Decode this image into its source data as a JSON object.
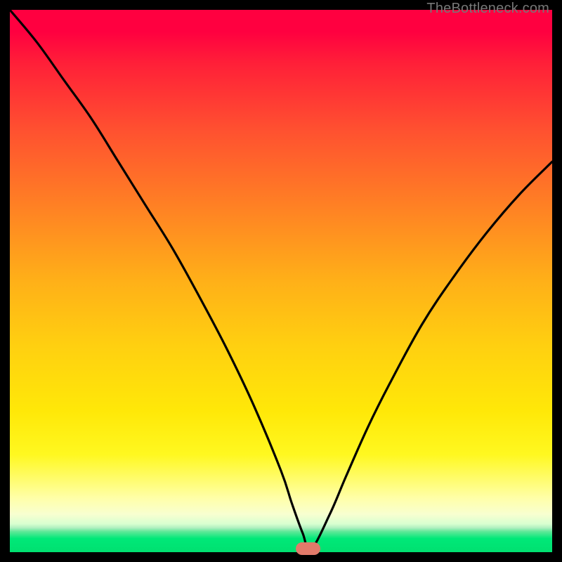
{
  "attribution": "TheBottleneck.com",
  "chart_data": {
    "type": "line",
    "title": "",
    "xlabel": "",
    "ylabel": "",
    "xlim": [
      0,
      100
    ],
    "ylim": [
      0,
      100
    ],
    "series": [
      {
        "name": "bottleneck-curve",
        "x": [
          0,
          5,
          10,
          15,
          20,
          25,
          30,
          35,
          40,
          45,
          50,
          52,
          54,
          55.5,
          59,
          62,
          66,
          70,
          76,
          82,
          88,
          94,
          100
        ],
        "values": [
          100,
          94,
          87,
          80,
          72,
          64,
          56,
          47,
          37.5,
          27,
          15,
          9,
          3.5,
          0.5,
          7,
          14,
          23,
          31,
          42,
          51,
          59,
          66,
          72
        ]
      }
    ],
    "marker": {
      "x": 55.0,
      "y": 0.7,
      "width_frac": 0.045
    },
    "background_gradient": {
      "type": "vertical",
      "stops": [
        {
          "pos": 0.0,
          "color": "#ff0040"
        },
        {
          "pos": 0.5,
          "color": "#ffb018"
        },
        {
          "pos": 0.82,
          "color": "#fff820"
        },
        {
          "pos": 0.93,
          "color": "#f8ffd0"
        },
        {
          "pos": 1.0,
          "color": "#00e070"
        }
      ]
    }
  }
}
